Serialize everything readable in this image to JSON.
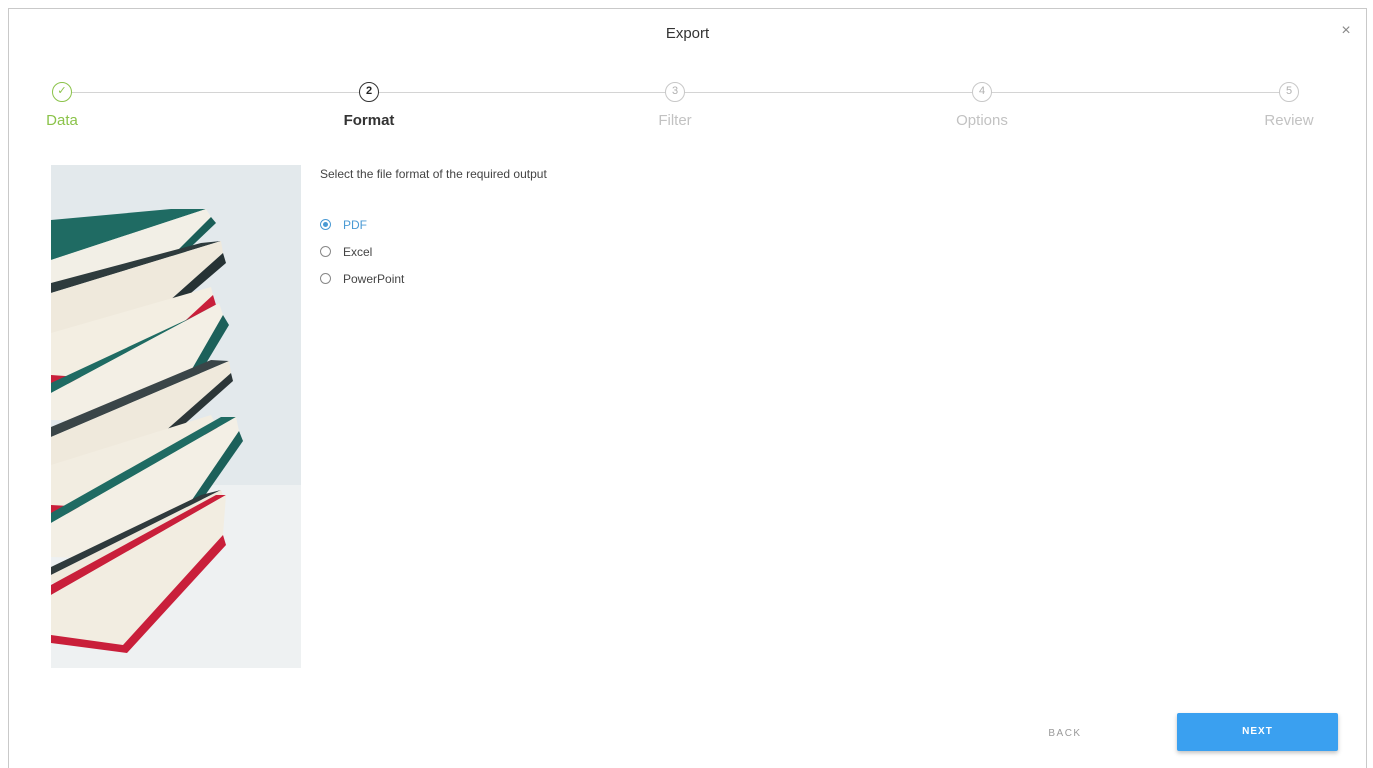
{
  "dialog": {
    "title": "Export",
    "close_glyph": "×"
  },
  "stepper": {
    "steps": [
      {
        "number": "✓",
        "label": "Data",
        "state": "done"
      },
      {
        "number": "2",
        "label": "Format",
        "state": "active"
      },
      {
        "number": "3",
        "label": "Filter",
        "state": "pending"
      },
      {
        "number": "4",
        "label": "Options",
        "state": "pending"
      },
      {
        "number": "5",
        "label": "Review",
        "state": "pending"
      }
    ]
  },
  "content": {
    "instructions": "Select the file format of the required output",
    "options": [
      {
        "label": "PDF",
        "selected": true
      },
      {
        "label": "Excel",
        "selected": false
      },
      {
        "label": "PowerPoint",
        "selected": false
      }
    ]
  },
  "footer": {
    "back_label": "BACK",
    "next_label": "NEXT"
  },
  "colors": {
    "accent": "#3aa0f0",
    "done": "#8bc34a",
    "selected_text": "#4a9ad4"
  },
  "icons": {
    "close": "close-icon",
    "done_step": "check-icon"
  }
}
